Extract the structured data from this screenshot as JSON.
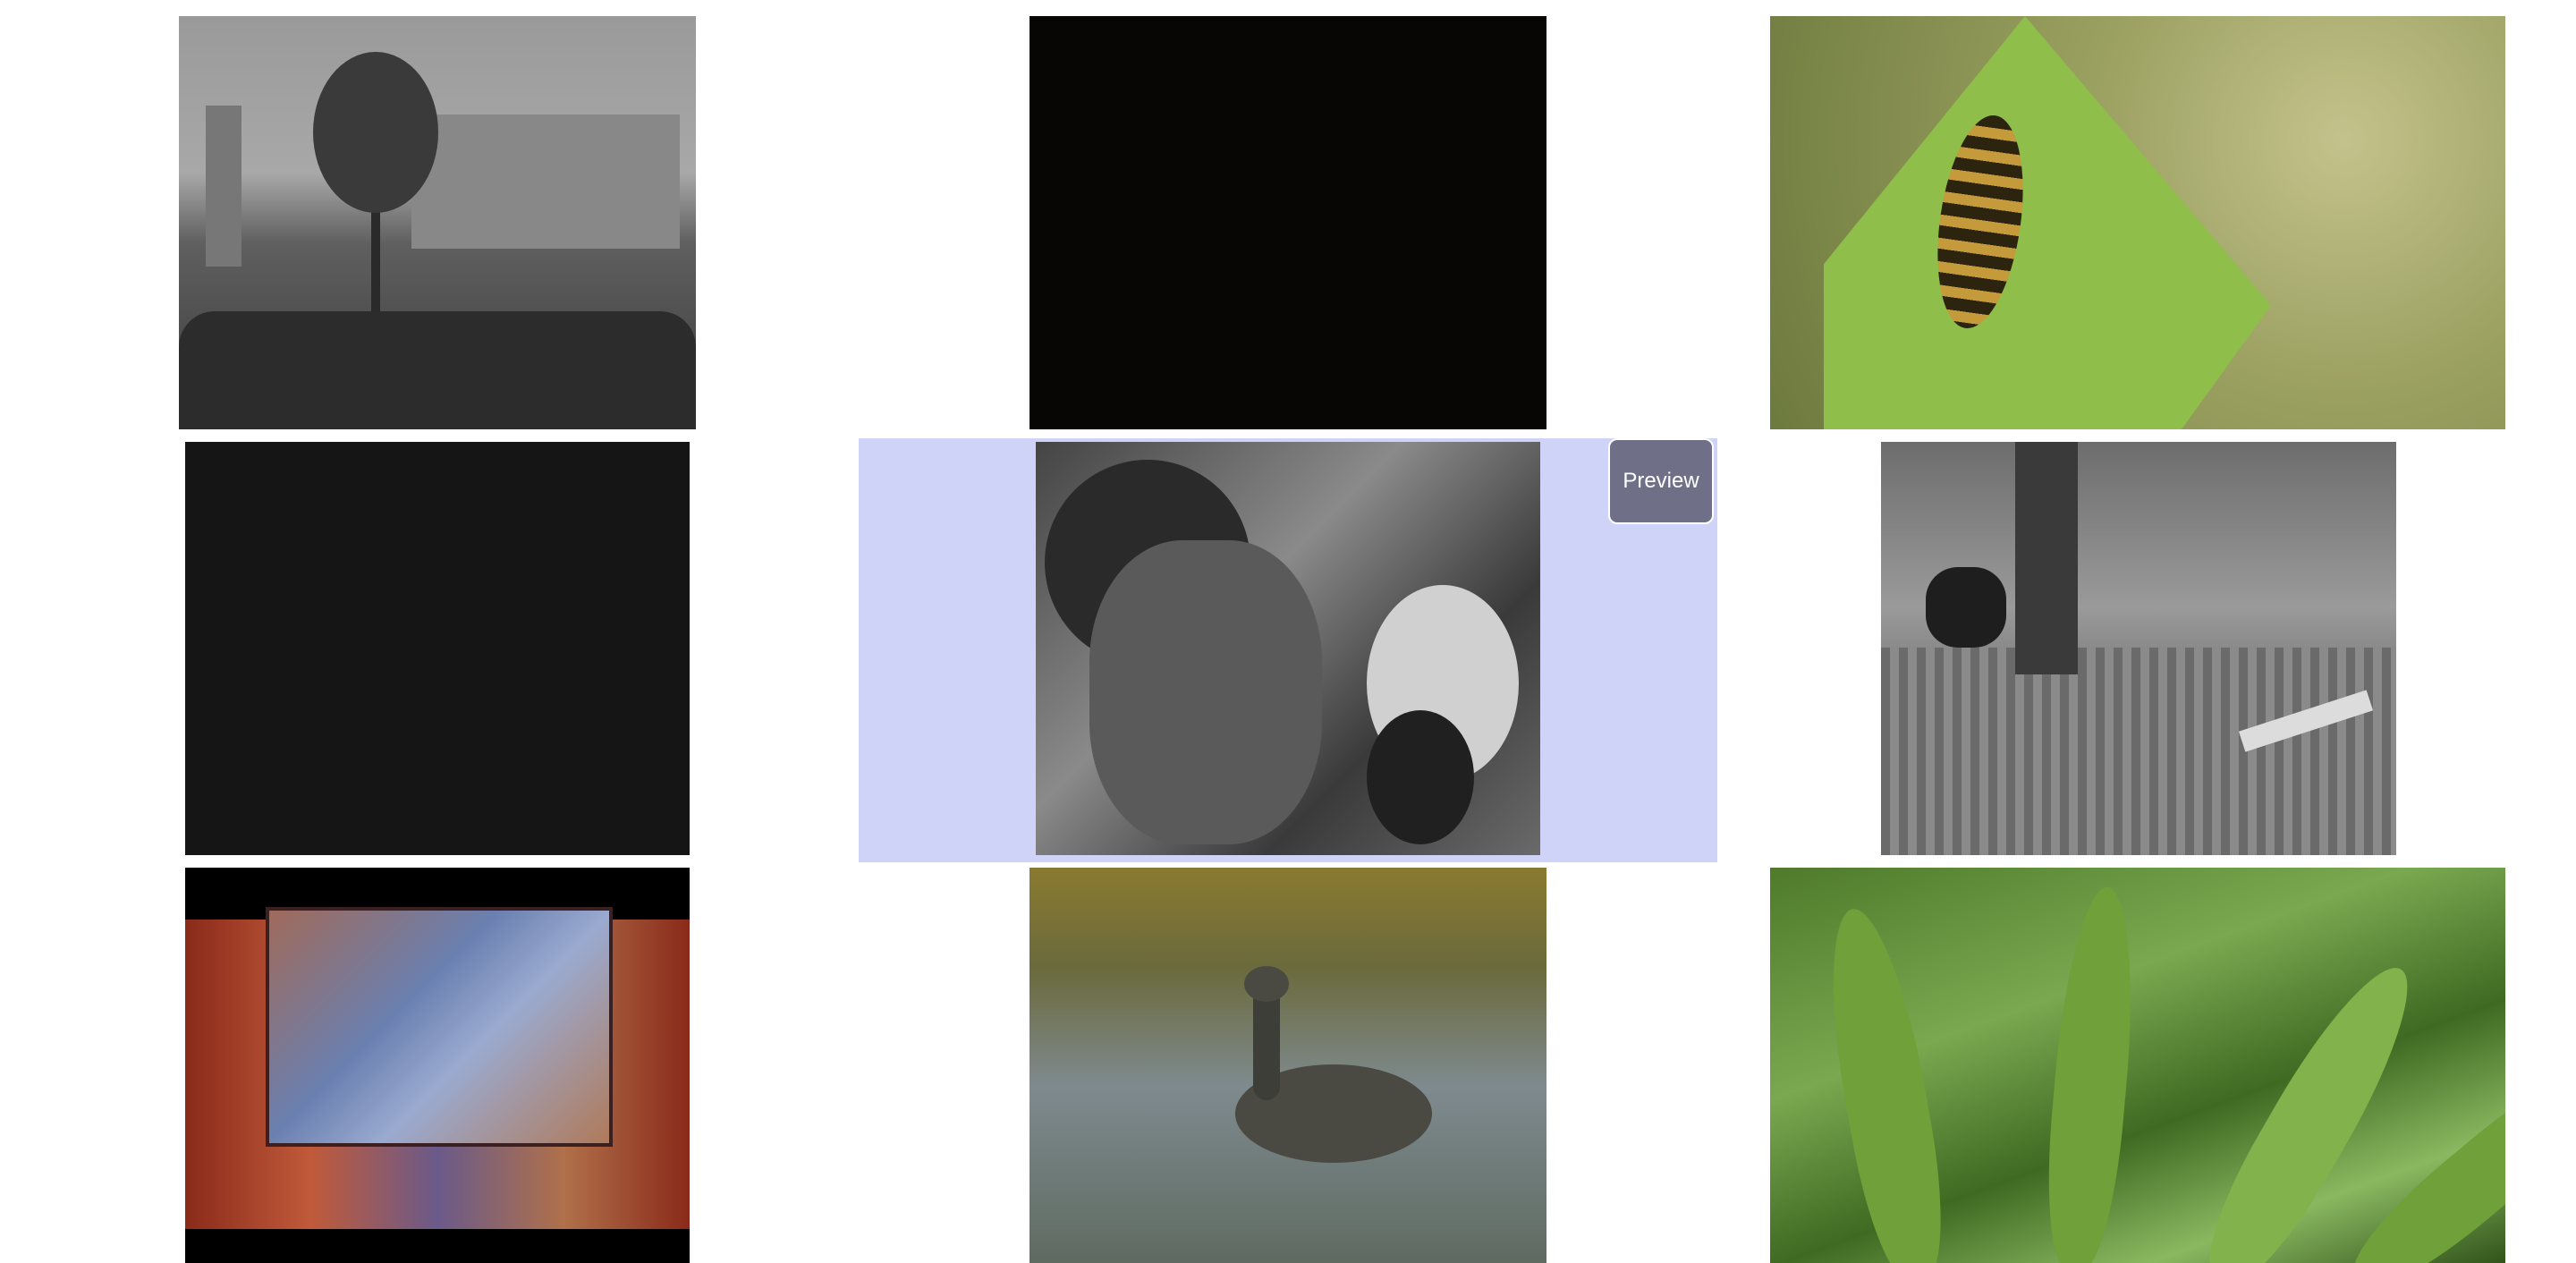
{
  "grid": {
    "selected_index": 4,
    "preview_label": "Preview",
    "tiles": [
      {
        "subject": "grayscale-city-tree"
      },
      {
        "subject": "black-frame"
      },
      {
        "subject": "hoverfly-on-leaf"
      },
      {
        "subject": "dark-gray-frame"
      },
      {
        "subject": "two-men-grayscale"
      },
      {
        "subject": "street-legs-grayscale"
      },
      {
        "subject": "colorful-title-card"
      },
      {
        "subject": "duck-on-water"
      },
      {
        "subject": "green-fern-leaves"
      }
    ]
  },
  "colors": {
    "selected_bg": "#d0d3f8",
    "preview_button_bg": "#6f7088",
    "page_bg": "#ffffff"
  }
}
